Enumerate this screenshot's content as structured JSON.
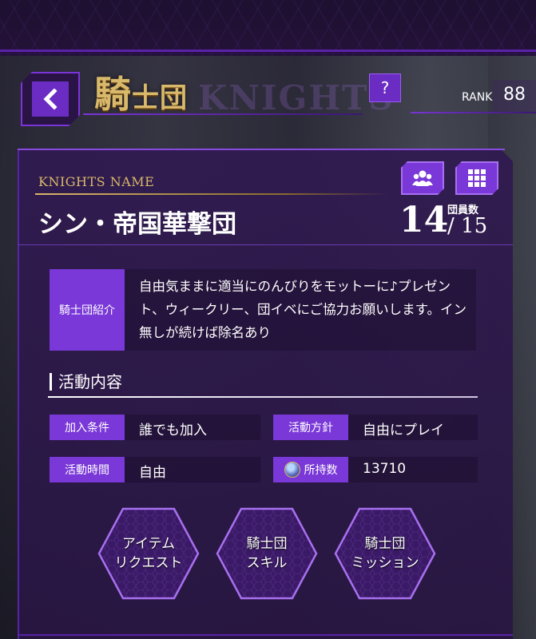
{
  "header": {
    "title_main": "騎",
    "title_rest": "士団",
    "title_watermark": "KNIGHTS",
    "back_icon": "chevron-left-icon",
    "help_label": "?",
    "rank_label": "RANK",
    "rank_value": "88"
  },
  "knights": {
    "name_label": "KNIGHTS NAME",
    "name": "シン・帝国華撃団",
    "members_icon": "group-icon",
    "menu_icon": "grid-icon",
    "members_label": "団員数",
    "members_count": "14",
    "members_max": "/ 15"
  },
  "intro": {
    "label": "騎士団紹介",
    "text": "自由気ままに適当にのんびりをモットーに♪プレゼント、ウィークリー、団イベにご協力お願いします。イン無しが続けば除名あり"
  },
  "activity": {
    "section_title": "活動内容",
    "join_label": "加入条件",
    "join_value": "誰でも加入",
    "policy_label": "活動方針",
    "policy_value": "自由にプレイ",
    "time_label": "活動時間",
    "time_value": "自由",
    "holdings_label": "所持数",
    "holdings_value": "13710",
    "holdings_icon": "medal-icon"
  },
  "buttons": {
    "item_request_line1": "アイテム",
    "item_request_line2": "リクエスト",
    "skill_line1": "騎士団",
    "skill_line2": "スキル",
    "mission_line1": "騎士団",
    "mission_line2": "ミッション"
  },
  "colors": {
    "accent": "#7a38d8",
    "gold": "#d8b86a",
    "panel": "#301a50"
  }
}
